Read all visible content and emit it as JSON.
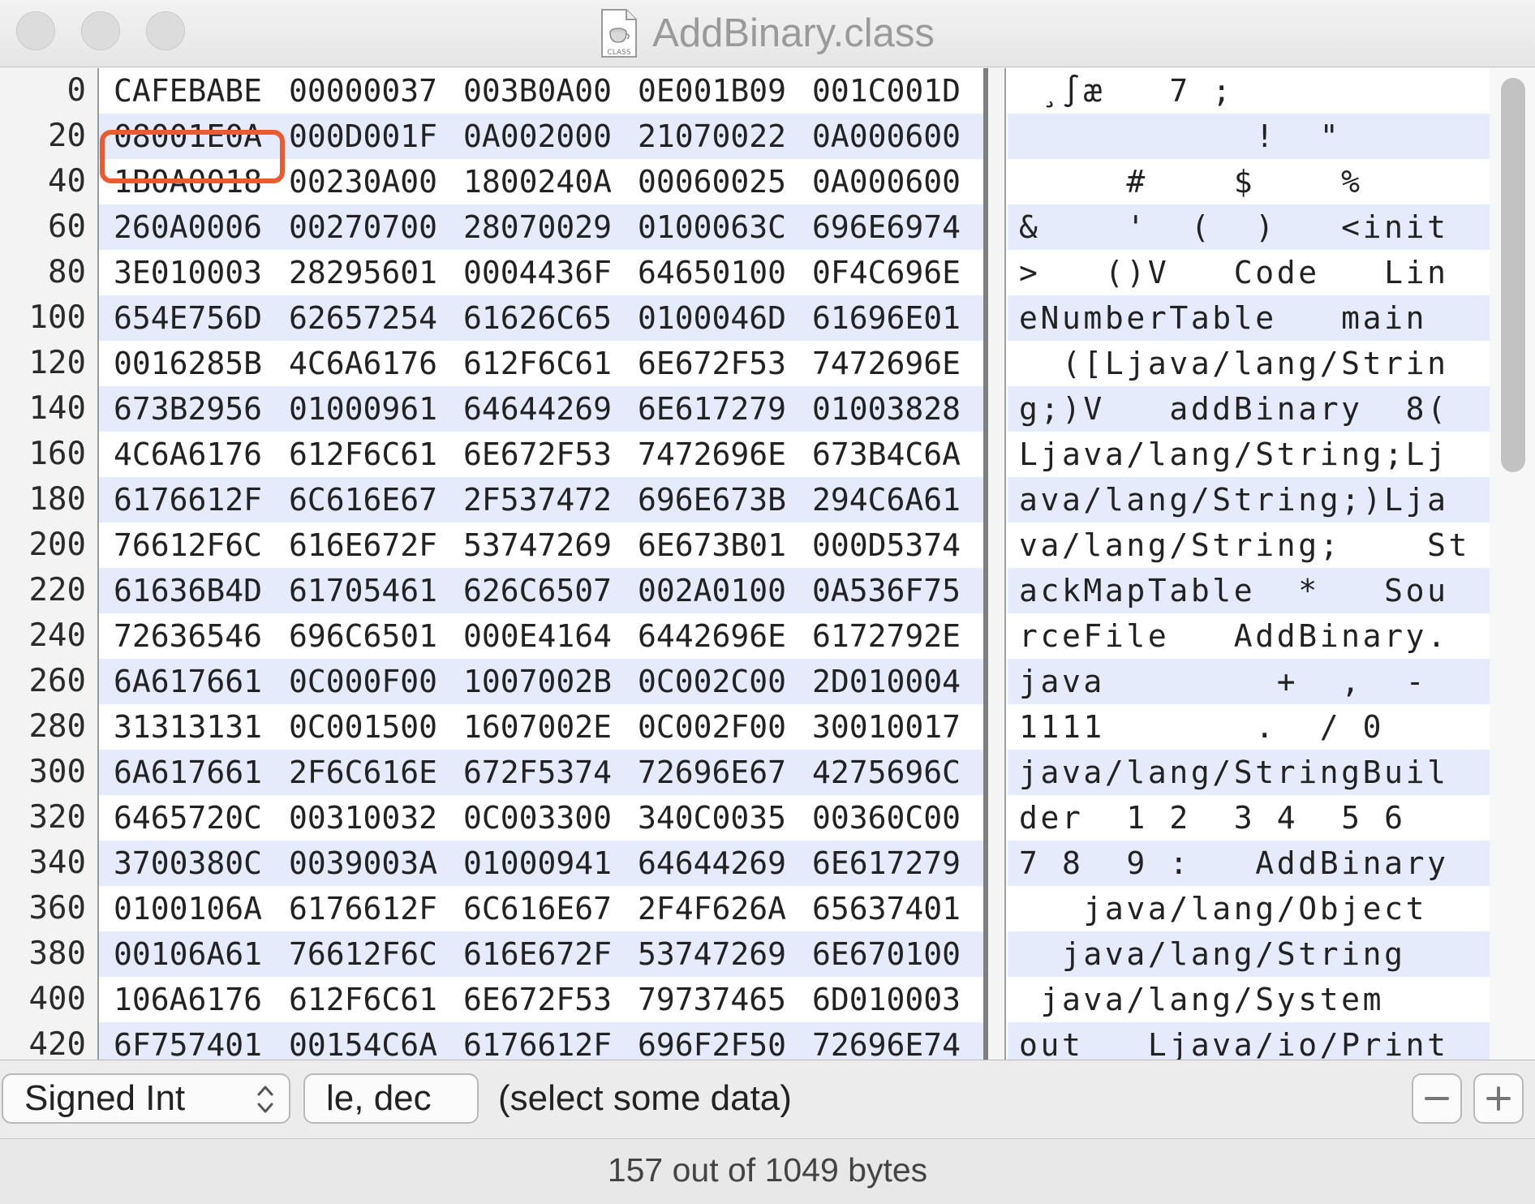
{
  "window": {
    "title": "AddBinary.class",
    "icon": "java-class-file-icon",
    "icon_text": "CLASS"
  },
  "rows": [
    {
      "offset": "0",
      "hex": [
        "CAFEBABE",
        "00000037",
        "003B0A00",
        "0E001B09",
        "001C001D"
      ],
      "ascii": " ¸∫æ   7 ;"
    },
    {
      "offset": "20",
      "hex": [
        "08001E0A",
        "000D001F",
        "0A002000",
        "21070022",
        "0A000600"
      ],
      "ascii": "           !  \""
    },
    {
      "offset": "40",
      "hex": [
        "1B0A0018",
        "00230A00",
        "1800240A",
        "00060025",
        "0A000600"
      ],
      "ascii": "     #    $    %"
    },
    {
      "offset": "60",
      "hex": [
        "260A0006",
        "00270700",
        "28070029",
        "0100063C",
        "696E6974"
      ],
      "ascii": "&    '  (  )   <init"
    },
    {
      "offset": "80",
      "hex": [
        "3E010003",
        "28295601",
        "0004436F",
        "64650100",
        "0F4C696E"
      ],
      "ascii": ">   ()V   Code   Lin"
    },
    {
      "offset": "100",
      "hex": [
        "654E756D",
        "62657254",
        "61626C65",
        "0100046D",
        "61696E01"
      ],
      "ascii": "eNumberTable   main"
    },
    {
      "offset": "120",
      "hex": [
        "0016285B",
        "4C6A6176",
        "612F6C61",
        "6E672F53",
        "7472696E"
      ],
      "ascii": "  ([Ljava/lang/Strin"
    },
    {
      "offset": "140",
      "hex": [
        "673B2956",
        "01000961",
        "64644269",
        "6E617279",
        "01003828"
      ],
      "ascii": "g;)V   addBinary  8("
    },
    {
      "offset": "160",
      "hex": [
        "4C6A6176",
        "612F6C61",
        "6E672F53",
        "7472696E",
        "673B4C6A"
      ],
      "ascii": "Ljava/lang/String;Lj"
    },
    {
      "offset": "180",
      "hex": [
        "6176612F",
        "6C616E67",
        "2F537472",
        "696E673B",
        "294C6A61"
      ],
      "ascii": "ava/lang/String;)Lja"
    },
    {
      "offset": "200",
      "hex": [
        "76612F6C",
        "616E672F",
        "53747269",
        "6E673B01",
        "000D5374"
      ],
      "ascii": "va/lang/String;    St"
    },
    {
      "offset": "220",
      "hex": [
        "61636B4D",
        "61705461",
        "626C6507",
        "002A0100",
        "0A536F75"
      ],
      "ascii": "ackMapTable  *   Sou"
    },
    {
      "offset": "240",
      "hex": [
        "72636546",
        "696C6501",
        "000E4164",
        "6442696E",
        "6172792E"
      ],
      "ascii": "rceFile   AddBinary."
    },
    {
      "offset": "260",
      "hex": [
        "6A617661",
        "0C000F00",
        "1007002B",
        "0C002C00",
        "2D010004"
      ],
      "ascii": "java        +  ,  -"
    },
    {
      "offset": "280",
      "hex": [
        "31313131",
        "0C001500",
        "1607002E",
        "0C002F00",
        "30010017"
      ],
      "ascii": "1111       .  / 0"
    },
    {
      "offset": "300",
      "hex": [
        "6A617661",
        "2F6C616E",
        "672F5374",
        "72696E67",
        "4275696C"
      ],
      "ascii": "java/lang/StringBuil"
    },
    {
      "offset": "320",
      "hex": [
        "6465720C",
        "00310032",
        "0C003300",
        "340C0035",
        "00360C00"
      ],
      "ascii": "der  1 2  3 4  5 6"
    },
    {
      "offset": "340",
      "hex": [
        "3700380C",
        "0039003A",
        "01000941",
        "64644269",
        "6E617279"
      ],
      "ascii": "7 8  9 :   AddBinary"
    },
    {
      "offset": "360",
      "hex": [
        "0100106A",
        "6176612F",
        "6C616E67",
        "2F4F626A",
        "65637401"
      ],
      "ascii": "   java/lang/Object"
    },
    {
      "offset": "380",
      "hex": [
        "00106A61",
        "76612F6C",
        "616E672F",
        "53747269",
        "6E670100"
      ],
      "ascii": "  java/lang/String"
    },
    {
      "offset": "400",
      "hex": [
        "106A6176",
        "612F6C61",
        "6E672F53",
        "79737465",
        "6D010003"
      ],
      "ascii": " java/lang/System"
    },
    {
      "offset": "420",
      "hex": [
        "6F757401",
        "00154C6A",
        "6176612F",
        "696F2F50",
        "72696E74"
      ],
      "ascii": "out   Ljava/io/Print"
    }
  ],
  "highlighted_group": "CAFEBABE",
  "colors": {
    "highlight_border": "#ec5a30",
    "alt_row": "#e5ebfa"
  },
  "infobar": {
    "type_select": "Signed Int",
    "endian_button": "le, dec",
    "hint": "(select some data)",
    "minus_icon": "minus-icon",
    "plus_icon": "plus-icon"
  },
  "status": {
    "text": "157 out of 1049 bytes"
  }
}
